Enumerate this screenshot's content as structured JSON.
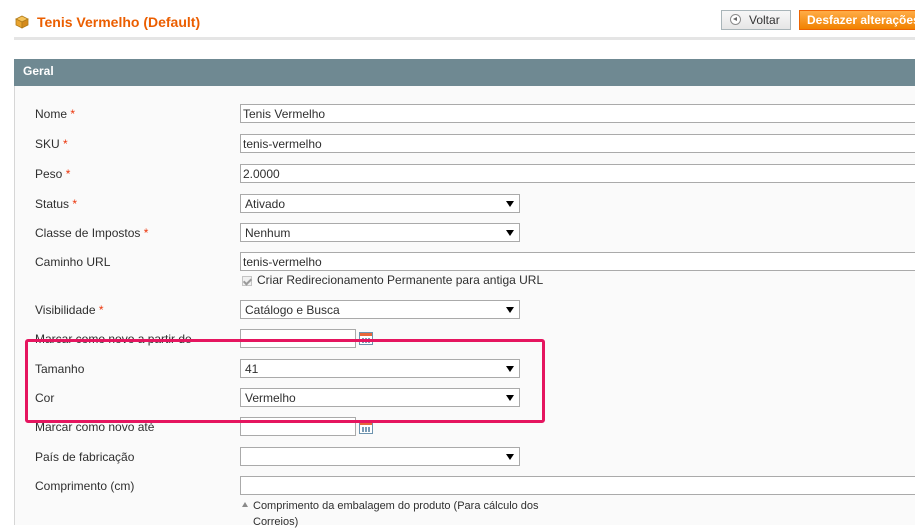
{
  "header": {
    "title": "Tenis Vermelho (Default)",
    "back_label": "Voltar",
    "reset_label": "Desfazer alterações"
  },
  "section": {
    "title": "Geral"
  },
  "fields": {
    "nome": {
      "label": "Nome",
      "required": "*",
      "value": "Tenis Vermelho"
    },
    "sku": {
      "label": "SKU",
      "required": "*",
      "value": "tenis-vermelho"
    },
    "peso": {
      "label": "Peso",
      "required": "*",
      "value": "2.0000"
    },
    "status": {
      "label": "Status",
      "required": "*",
      "value": "Ativado"
    },
    "classe_impostos": {
      "label": "Classe de Impostos",
      "required": "*",
      "value": "Nenhum"
    },
    "caminho_url": {
      "label": "Caminho URL",
      "value": "tenis-vermelho",
      "redirect_label": "Criar Redirecionamento Permanente para antiga URL",
      "redirect_checked": true
    },
    "visibilidade": {
      "label": "Visibilidade",
      "required": "*",
      "value": "Catálogo e Busca"
    },
    "novo_de": {
      "label": "Marcar como novo a partir de",
      "value": ""
    },
    "tamanho": {
      "label": "Tamanho",
      "value": "41"
    },
    "cor": {
      "label": "Cor",
      "value": "Vermelho"
    },
    "novo_ate": {
      "label": "Marcar como novo até",
      "value": ""
    },
    "pais": {
      "label": "País de fabricação",
      "value": ""
    },
    "comprimento": {
      "label": "Comprimento (cm)",
      "value": "",
      "note": "Comprimento da embalagem do produto (Para cálculo dos Correios)"
    }
  },
  "colors": {
    "title": "#eb5e00",
    "primary_button": "#f18200",
    "section_header": "#6f8992",
    "highlight": "#e5155f",
    "required": "#eb340a"
  },
  "icons": [
    "package-icon",
    "back-arrow-icon",
    "calendar-icon",
    "check-icon",
    "dropdown-caret-icon",
    "note-arrow-icon"
  ]
}
